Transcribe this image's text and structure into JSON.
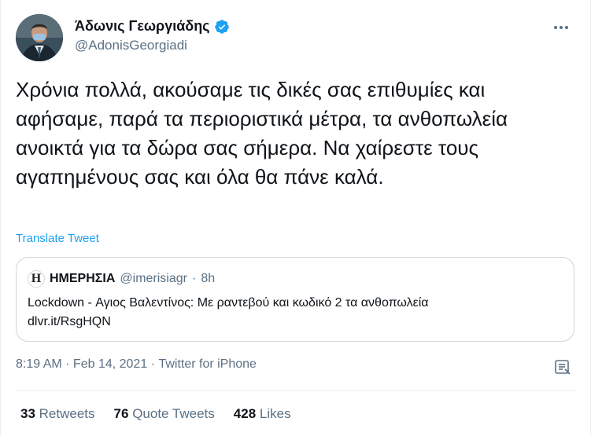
{
  "author": {
    "display_name": "Άδωνις Γεωργιάδης",
    "handle": "@AdonisGeorgiadi",
    "verified": true,
    "avatar_icon": "profile-photo"
  },
  "tweet": {
    "text": "Χρόνια πολλά, ακούσαμε τις δικές σας επιθυμίες και αφήσαμε, παρά τα περιοριστικά μέτρα, τα ανθοπωλεία ανοικτά για τα δώρα σας σήμερα. Να χαίρεστε τους αγαπημένους σας και όλα θα πάνε καλά.",
    "translate_label": "Translate Tweet"
  },
  "quote": {
    "logo_letter": "H",
    "name": "ΗΜΕΡΗΣΙΑ",
    "handle": "@imerisiagr",
    "separator": "·",
    "age": "8h",
    "text": "Lockdown - Αγιος Βαλεντίνος: Με ραντεβού και κωδικό 2 τα ανθοπωλεία",
    "link": "dlvr.it/RsgHQN"
  },
  "meta": {
    "time": "8:19 AM",
    "sep1": " · ",
    "date": "Feb 14, 2021",
    "sep2": " · ",
    "source": "Twitter for iPhone"
  },
  "stats": {
    "retweets_count": "33",
    "retweets_label": "Retweets",
    "quotes_count": "76",
    "quotes_label": "Quote Tweets",
    "likes_count": "428",
    "likes_label": "Likes"
  },
  "colors": {
    "accent": "#1da1f2",
    "text_primary": "#0f1419",
    "text_secondary": "#5b7083",
    "border": "#ccd6dd"
  },
  "icons": {
    "verified": "verified-badge-icon",
    "more": "more-horizontal-icon",
    "analytics": "analytics-icon"
  }
}
